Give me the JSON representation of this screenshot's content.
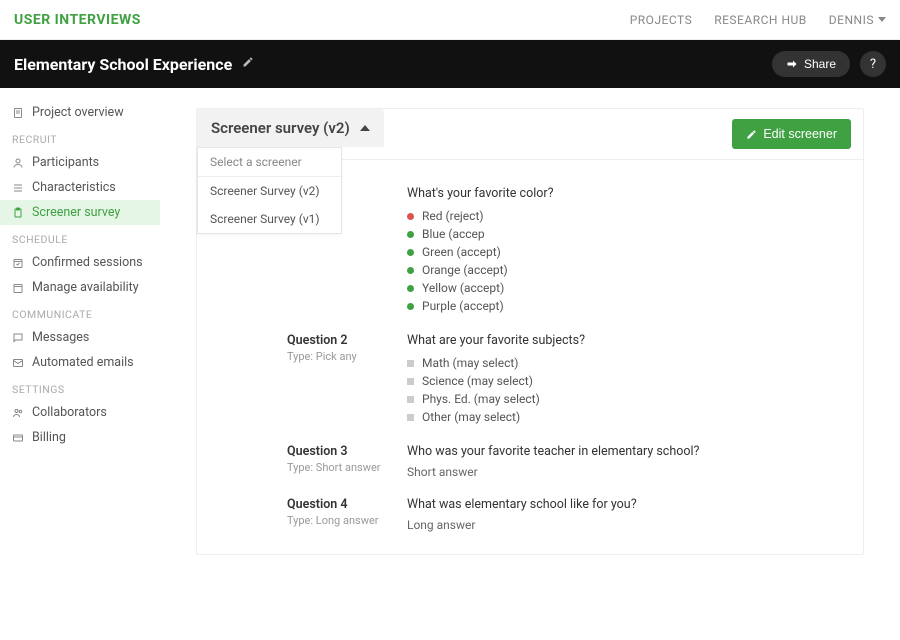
{
  "brand": "USER INTERVIEWS",
  "topnav": {
    "projects": "PROJECTS",
    "research": "RESEARCH HUB",
    "user": "DENNIS"
  },
  "project": {
    "title": "Elementary School Experience",
    "share": "Share",
    "help": "?"
  },
  "sidebar": {
    "overview": "Project overview",
    "recruit_label": "RECRUIT",
    "participants": "Participants",
    "characteristics": "Characteristics",
    "screener": "Screener survey",
    "schedule_label": "SCHEDULE",
    "confirmed": "Confirmed sessions",
    "availability": "Manage availability",
    "communicate_label": "COMMUNICATE",
    "messages": "Messages",
    "emails": "Automated emails",
    "settings_label": "SETTINGS",
    "collaborators": "Collaborators",
    "billing": "Billing"
  },
  "screener": {
    "dropdown_label": "Screener survey (v2)",
    "dropdown_heading": "Select a screener",
    "options": {
      "0": "Screener Survey (v2)",
      "1": "Screener Survey (v1)"
    },
    "edit_label": "Edit screener"
  },
  "questions": {
    "0": {
      "prompt": "What's your favorite color?",
      "opts": {
        "0": "Red (reject)",
        "1": "Blue (accep",
        "2": "Green (accept)",
        "3": "Orange (accept)",
        "4": "Yellow (accept)",
        "5": "Purple (accept)"
      }
    },
    "1": {
      "name": "Question 2",
      "type": "Type: Pick any",
      "prompt": "What are your favorite subjects?",
      "opts": {
        "0": "Math (may select)",
        "1": "Science (may select)",
        "2": "Phys. Ed. (may select)",
        "3": "Other (may select)"
      }
    },
    "2": {
      "name": "Question 3",
      "type": "Type: Short answer",
      "prompt": "Who was your favorite teacher in elementary school?",
      "answer": "Short answer"
    },
    "3": {
      "name": "Question 4",
      "type": "Type: Long answer",
      "prompt": "What was elementary school like for you?",
      "answer": "Long answer"
    }
  }
}
